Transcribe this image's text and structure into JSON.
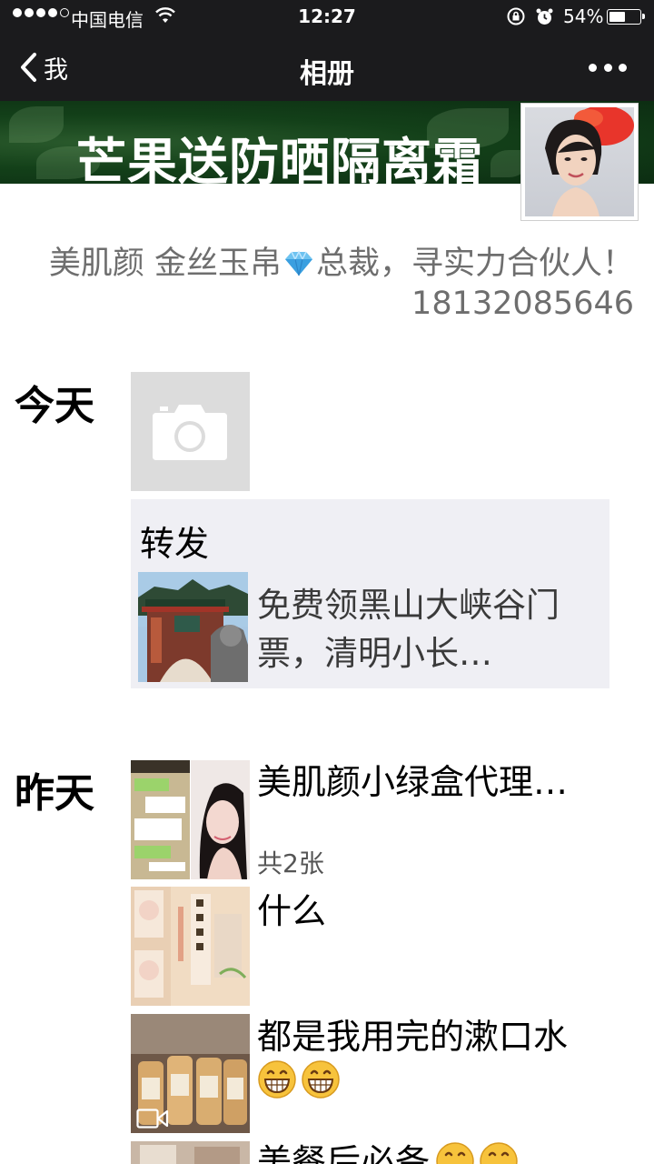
{
  "status_bar": {
    "carrier": "中国电信",
    "time": "12:27",
    "battery_percent": "54%",
    "battery_level": 0.54,
    "icons": [
      "signal-dots-icon",
      "wifi-icon",
      "rotation-lock-icon",
      "alarm-icon",
      "battery-icon"
    ]
  },
  "nav": {
    "back_label": "我",
    "title": "相册",
    "more_icon": "ellipsis-icon"
  },
  "profile": {
    "cover_text": "芒果送防晒隔离霜",
    "signature_part1": "美肌颜  金丝玉帛",
    "signature_emoji": "gem-icon",
    "signature_part2": "总裁，寻实力合伙人！18132085646"
  },
  "timeline": {
    "today_label": "今天",
    "yesterday_label": "昨天",
    "today_photo_icon": "camera-icon",
    "share": {
      "label": "转发",
      "title": "免费领黑山大峡谷门票，清明小长…"
    },
    "posts": [
      {
        "text": "美肌颜小绿盒代理…",
        "count": "共2张"
      },
      {
        "text": "什么"
      },
      {
        "text": "都是我用完的漱口水",
        "emoji_count": 2,
        "media_icon": "video-icon"
      },
      {
        "text": "美餐后必备"
      }
    ]
  }
}
